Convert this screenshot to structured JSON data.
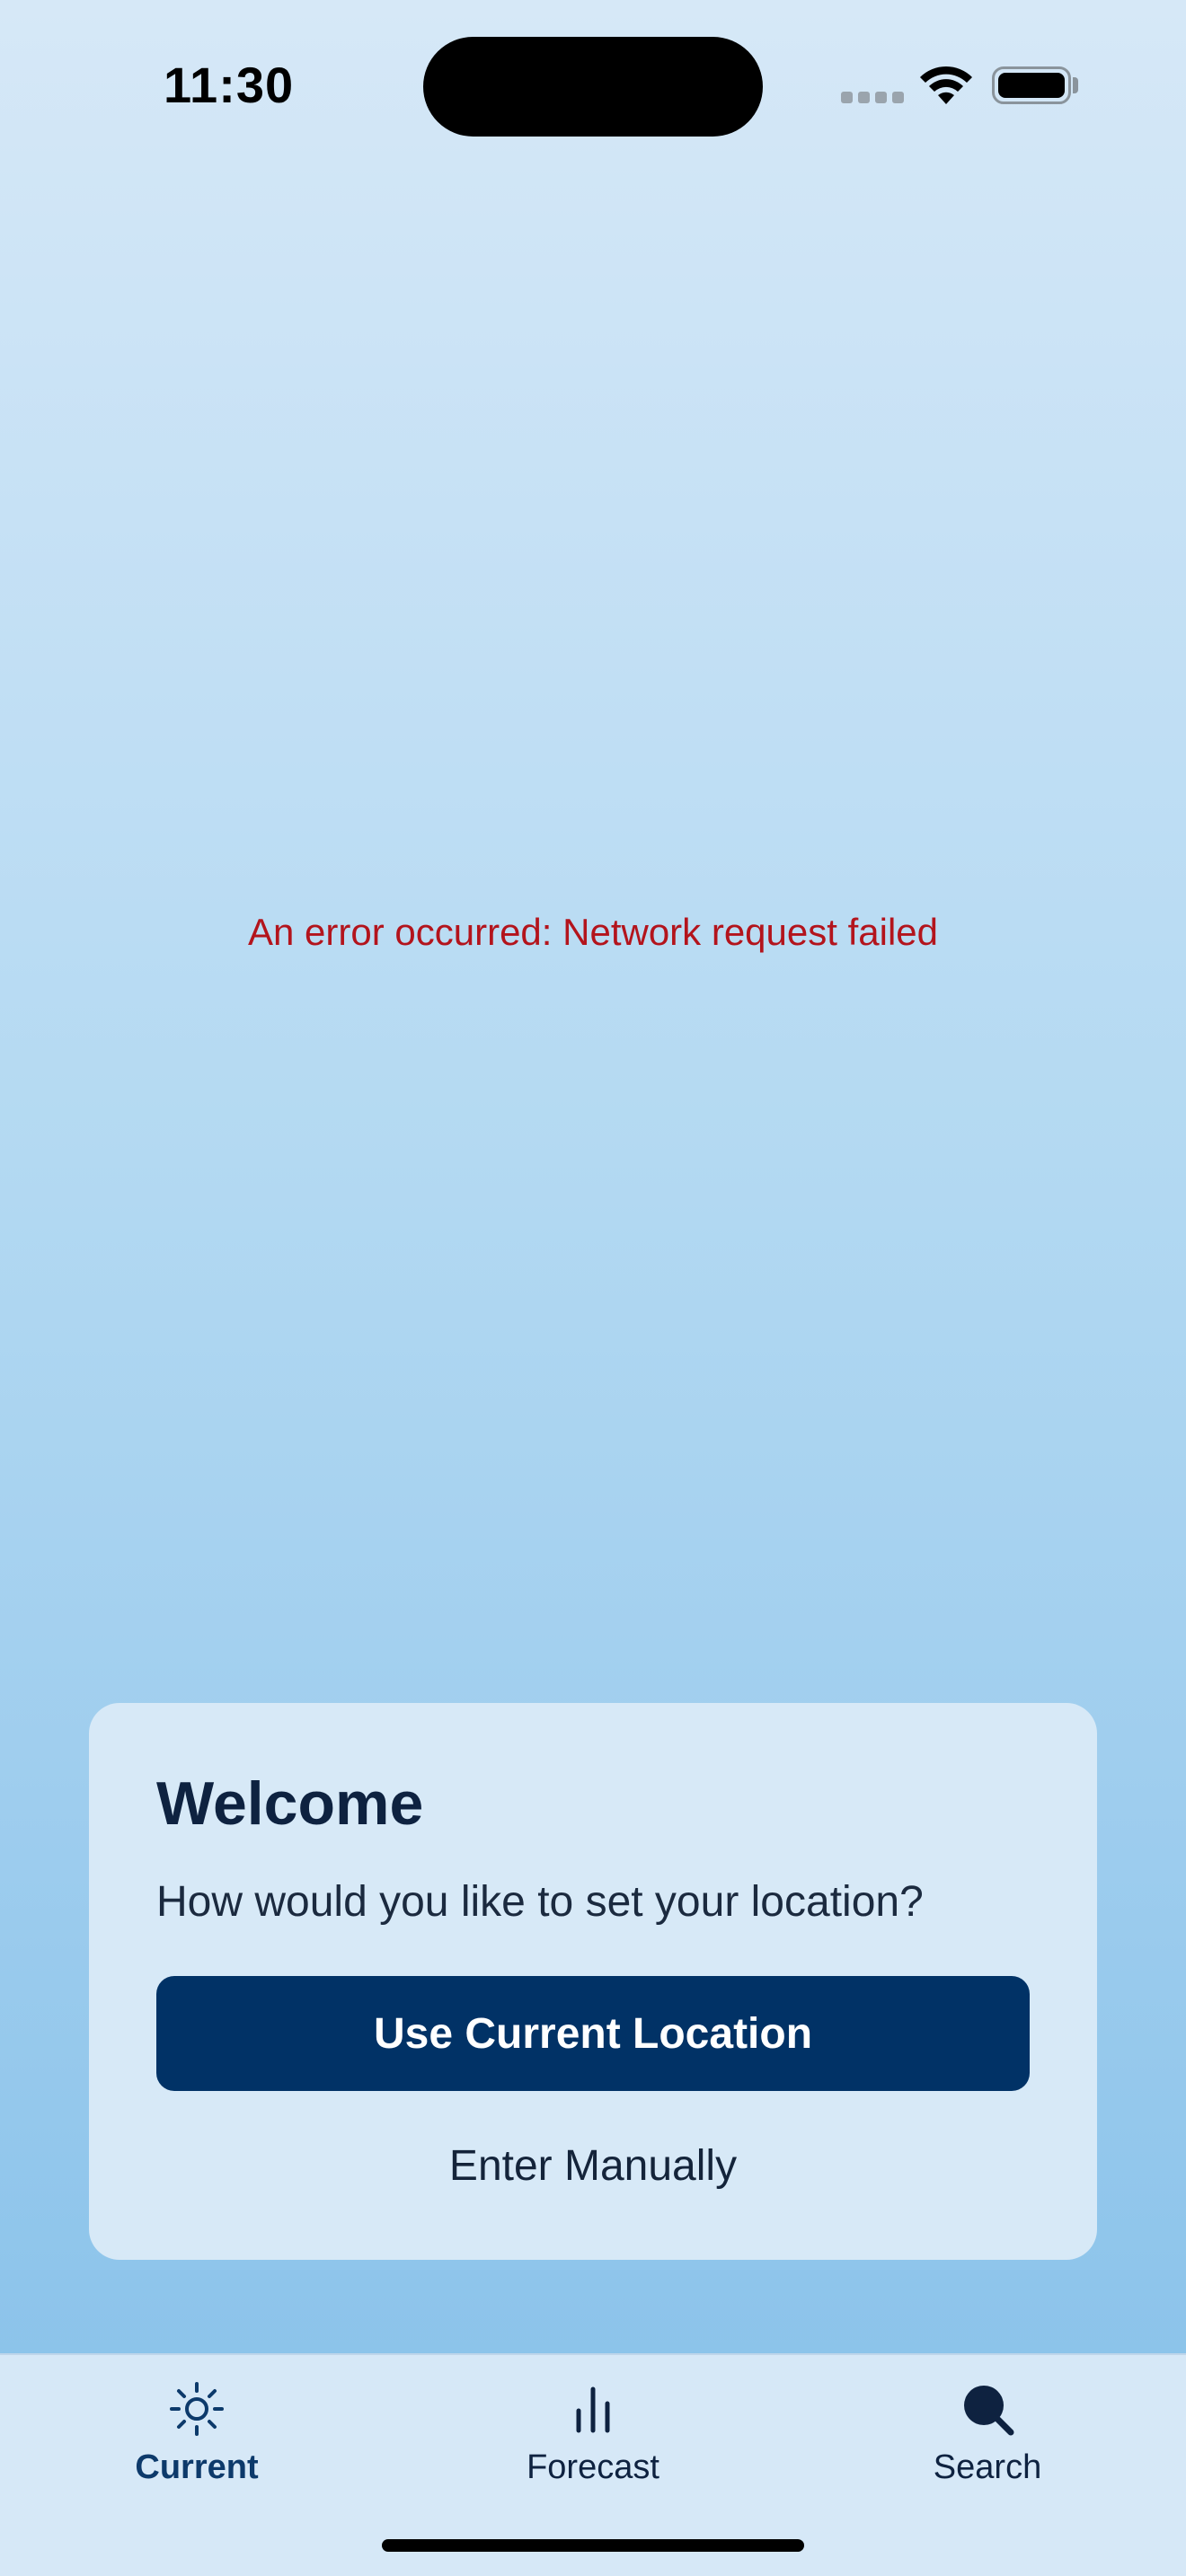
{
  "status_bar": {
    "time": "11:30"
  },
  "error": {
    "message": "An error occurred: Network request failed"
  },
  "welcome_card": {
    "title": "Welcome",
    "subtitle": "How would you like to set your location?",
    "primary_button_label": "Use Current Location",
    "secondary_button_label": "Enter Manually"
  },
  "tabbar": {
    "tabs": [
      {
        "label": "Current",
        "icon": "sun-icon",
        "active": true
      },
      {
        "label": "Forecast",
        "icon": "bar-chart-icon",
        "active": false
      },
      {
        "label": "Search",
        "icon": "search-icon",
        "active": false
      }
    ]
  },
  "colors": {
    "primary": "#013266",
    "error": "#b3141c",
    "card_background": "#d7e9f7",
    "text_dark": "#0e2240"
  }
}
